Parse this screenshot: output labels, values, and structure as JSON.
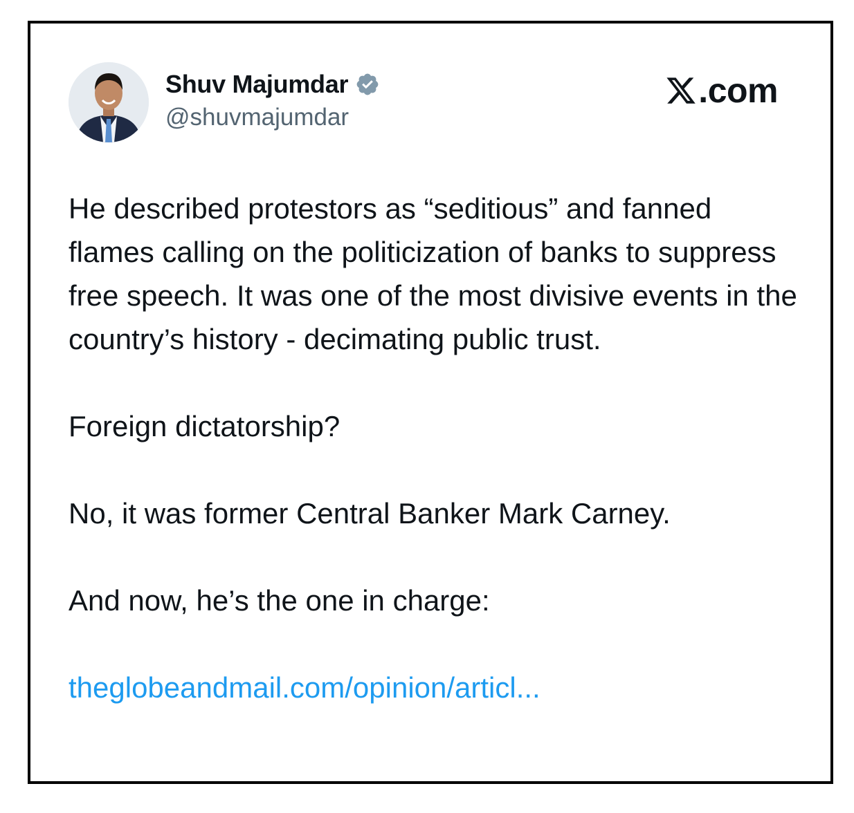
{
  "tweet": {
    "author": {
      "display_name": "Shuv Majumdar",
      "handle": "@shuvmajumdar",
      "verified": true,
      "verified_icon": "verified-badge-icon"
    },
    "brand": {
      "logo_icon": "x-logo-icon",
      "suffix": ".com"
    },
    "body": {
      "paragraph_1": "He described protestors as “seditious” and fanned flames calling on the politicization of banks to suppress free speech. It was one of the most divisive events in the country’s history - decimating public trust.",
      "paragraph_2": "Foreign dictatorship?",
      "paragraph_3": "No, it was former Central Banker Mark Carney.",
      "paragraph_4": "And now, he’s the one in charge:",
      "link_text": "theglobeandmail.com/opinion/articl..."
    }
  },
  "colors": {
    "text": "#0f1419",
    "secondary_text": "#536471",
    "link": "#1d9bf0",
    "verified_badge": "#829aab",
    "frame_border": "#000000"
  }
}
